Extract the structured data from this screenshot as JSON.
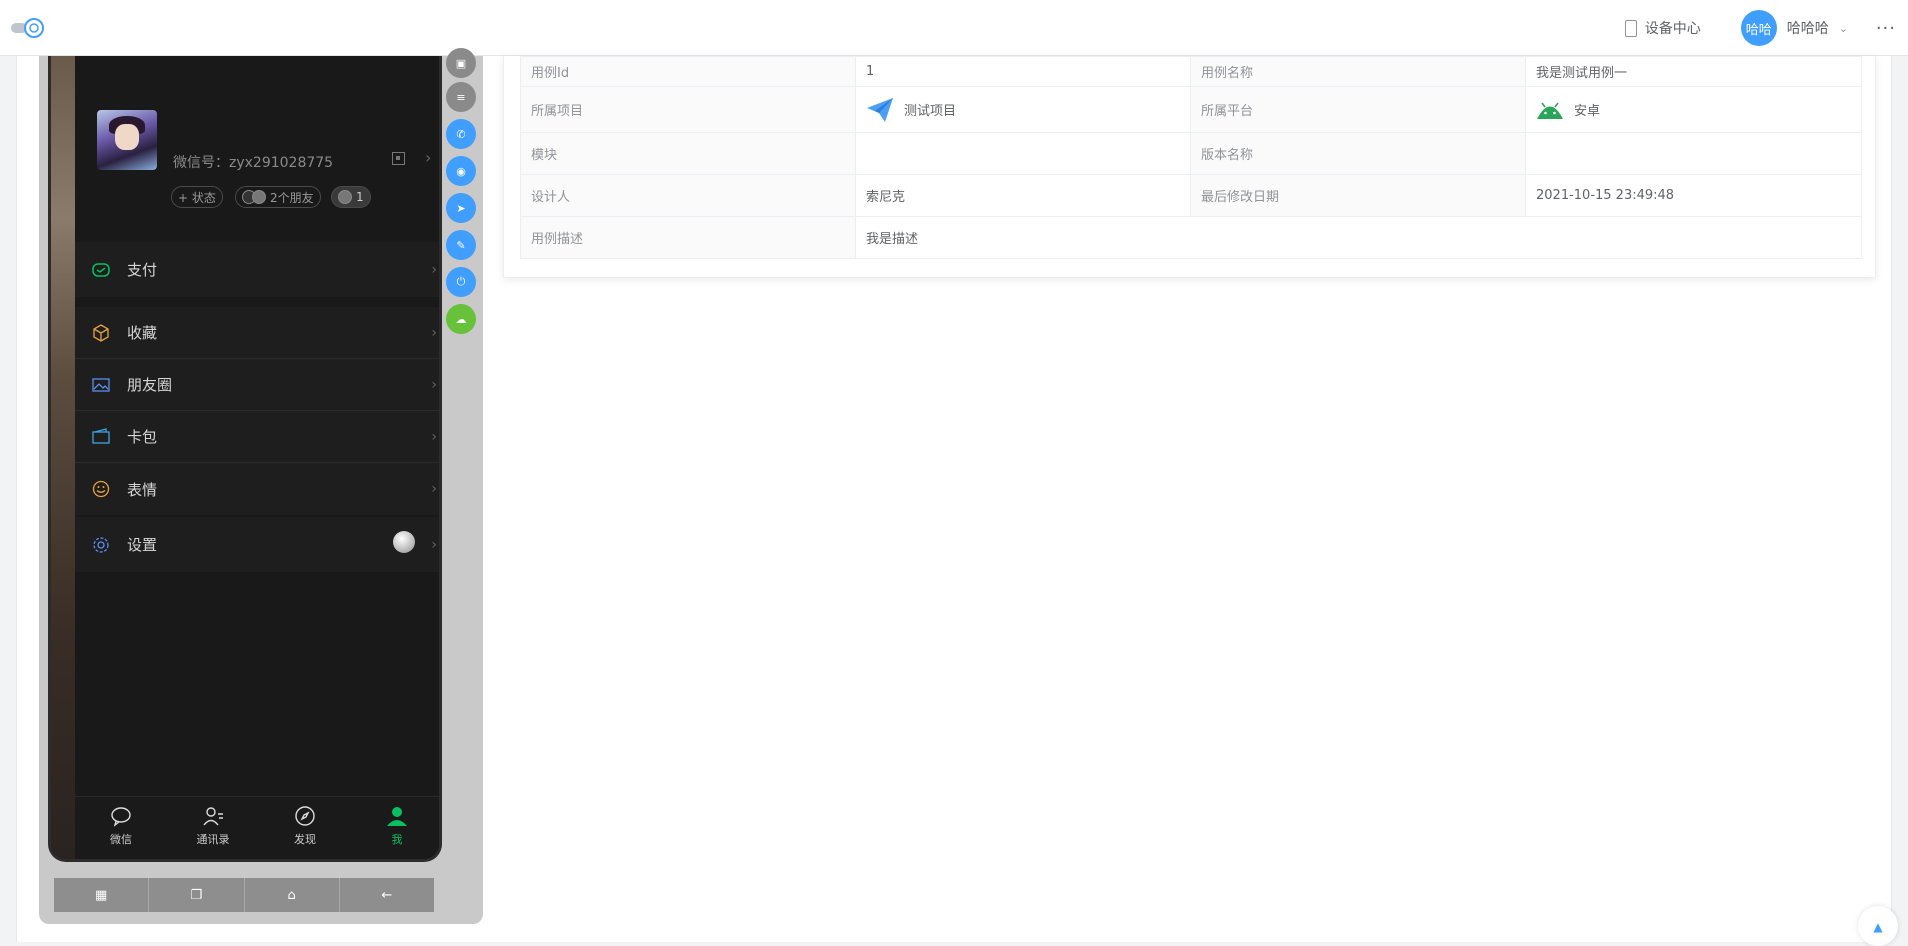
{
  "header": {
    "device_center": "设备中心",
    "user_avatar_text": "哈哈",
    "user_name": "哈哈哈",
    "more": "···"
  },
  "phone": {
    "wechat_id": "微信号：zyx291028775",
    "status_pill": "+ 状态",
    "friends_pill": "2个朋友",
    "count_pill": "1",
    "menu": {
      "pay": "支付",
      "favorites": "收藏",
      "moments": "朋友圈",
      "cards": "卡包",
      "stickers": "表情",
      "settings": "设置"
    },
    "tabs": [
      "微信",
      "通讯录",
      "发现",
      "我"
    ],
    "arrow": "›"
  },
  "navbar": {
    "apps": "▦",
    "recent": "❐",
    "home": "⌂",
    "back": "←"
  },
  "case_detail": {
    "labels": {
      "case_id": "用例Id",
      "case_name": "用例名称",
      "project": "所属项目",
      "platform": "所属平台",
      "module": "模块",
      "version": "版本名称",
      "designer": "设计人",
      "modified": "最后修改日期",
      "description": "用例描述"
    },
    "values": {
      "case_id": "1",
      "case_name": "我是测试用例一",
      "project": "测试项目",
      "platform": "安卓",
      "module": "",
      "version": "",
      "designer": "索尼克",
      "modified": "2021-10-15 23:49:48",
      "description": "我是描述"
    }
  },
  "colors": {
    "primary": "#409eff",
    "success": "#67c23a",
    "wechat_green": "#07c160"
  }
}
